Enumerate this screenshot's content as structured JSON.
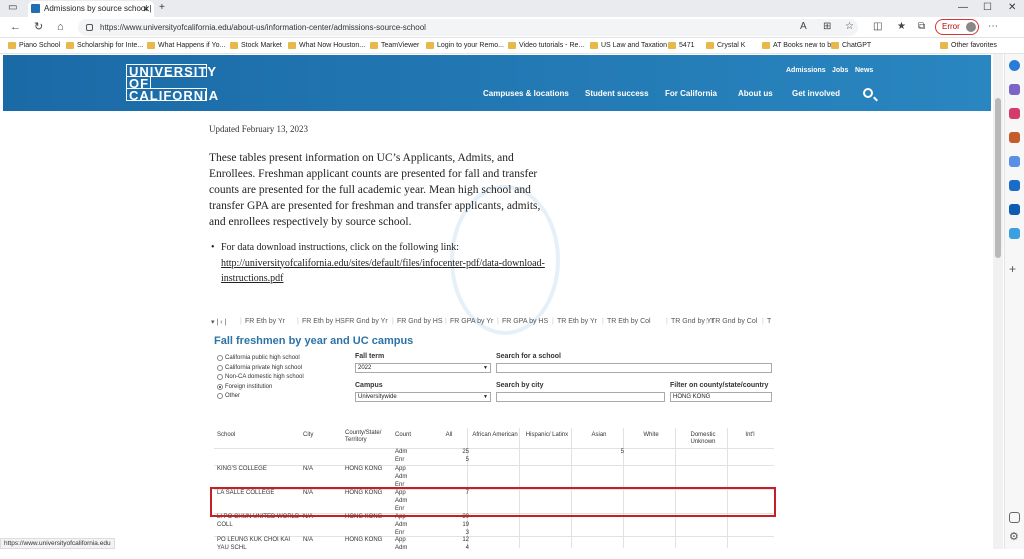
{
  "browser": {
    "tab_title": "Admissions by source school | U",
    "url": "https://www.universityofcalifornia.edu/about-us/information-center/admissions-source-school",
    "error_label": "Error",
    "status_url": "https://www.universityofcalifornia.edu",
    "bookmarks": [
      "Piano School",
      "Scholarship for Inte...",
      "What Happens if Yo...",
      "Stock Market",
      "What Now Houston...",
      "TeamViewer",
      "Login to your Remo...",
      "Video tutorials - Re...",
      "US Law and Taxation",
      "5471",
      "Crystal K",
      "AT Books new to buy",
      "ChatGPT"
    ],
    "other_favorites": "Other favorites"
  },
  "site": {
    "logo_lines": [
      "UNIVERSITY",
      "OF",
      "CALIFORNIA"
    ],
    "top_links": [
      "Admissions",
      "Jobs",
      "News"
    ],
    "main_nav": [
      "Campuses & locations",
      "Student success",
      "For California",
      "About us",
      "Get involved"
    ]
  },
  "content": {
    "updated": "Updated February 13, 2023",
    "intro": "These tables present information on UC’s Applicants, Admits, and Enrollees. Freshman applicant counts are presented for fall and transfer counts are presented for the full academic year.  Mean high school and transfer GPA are presented for freshman and transfer applicants, admits, and enrollees respectively by source school.",
    "bullet_prefix": "For data download instructions, click on the following link: ",
    "bullet_link": "http://universityofcalifornia.edu/sites/default/files/infocenter-pdf/data-download-instructions.pdf"
  },
  "tableau": {
    "tabs": [
      "FR Eth by Yr",
      "FR Eth by HS",
      "FR Gnd by Yr",
      "FR Gnd by HS",
      "FR GPA by Yr",
      "FR GPA by HS",
      "TR Eth by Yr",
      "TR Eth by Col",
      "TR Gnd by Yr",
      "TR Gnd by Col",
      "T"
    ],
    "title": "Fall freshmen by year and UC campus",
    "school_types": [
      "California public high school",
      "California private high school",
      "Non-CA domestic high school",
      "Foreign institution",
      "Other"
    ],
    "selected_type": "Foreign institution",
    "fall_term_label": "Fall term",
    "fall_term_value": "2022",
    "search_school_label": "Search for a school",
    "campus_label": "Campus",
    "campus_value": "Universitywide",
    "search_city_label": "Search by city",
    "filter_label": "Filter on county/state/country",
    "filter_value": "HONG KONG",
    "columns": [
      "School",
      "City",
      "County/State/ Territory",
      "Count",
      "All",
      "African American",
      "Hispanic/ Latinx",
      "Asian",
      "White",
      "Domestic Unknown",
      "Int'l"
    ],
    "rows": [
      {
        "school": "",
        "city": "",
        "county": "",
        "counts": [
          "Adm",
          "Enr"
        ],
        "all": [
          "25",
          "5"
        ],
        "asian": [
          "5",
          ""
        ]
      },
      {
        "school": "KING'S COLLEGE",
        "city": "N/A",
        "county": "HONG KONG",
        "counts": [
          "App",
          "Adm",
          "Enr"
        ],
        "all": [
          "",
          "",
          ""
        ],
        "asian": [
          "",
          "",
          ""
        ]
      },
      {
        "school": "LA SALLE COLLEGE",
        "city": "N/A",
        "county": "HONG KONG",
        "counts": [
          "App",
          "Adm",
          "Enr"
        ],
        "all": [
          "7",
          "",
          ""
        ],
        "asian": [
          "",
          "",
          ""
        ]
      },
      {
        "school": "LI PO CHUN UNITED WORLD COLL",
        "city": "N/A",
        "county": "HONG KONG",
        "counts": [
          "App",
          "Adm",
          "Enr"
        ],
        "all": [
          "30",
          "19",
          "3"
        ],
        "asian": [
          "",
          "",
          ""
        ]
      },
      {
        "school": "PO LEUNG KUK CHOI KAI YAU SCHL",
        "city": "N/A",
        "county": "HONG KONG",
        "counts": [
          "App",
          "Adm"
        ],
        "all": [
          "12",
          "4"
        ],
        "asian": [
          "",
          ""
        ]
      }
    ]
  }
}
